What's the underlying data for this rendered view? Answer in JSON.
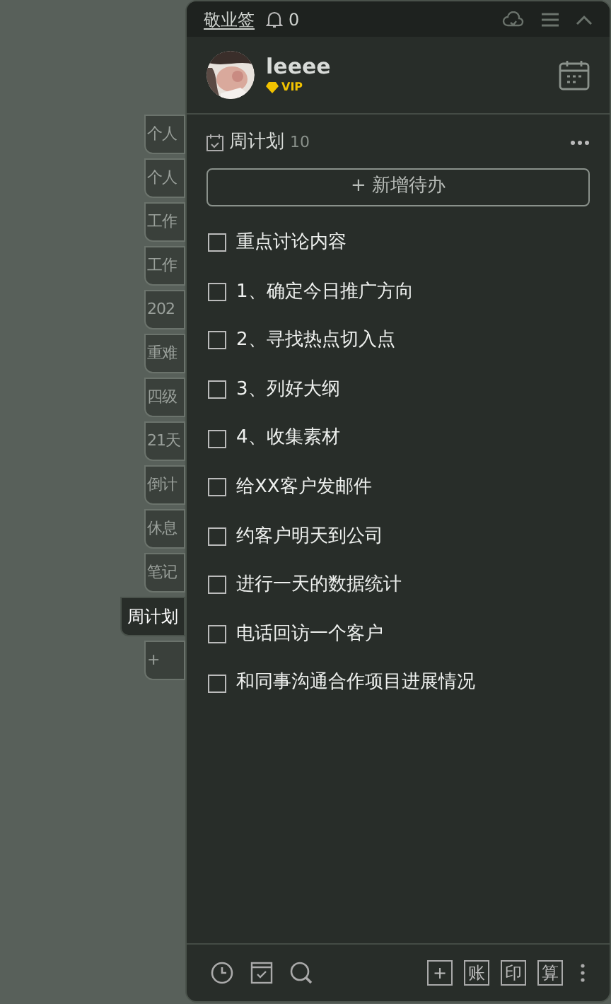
{
  "header": {
    "app_name": "敬业签",
    "notification_count": "0"
  },
  "user": {
    "name": "leeee",
    "badge": "VIP"
  },
  "side_tabs": [
    {
      "label": "个人",
      "selected": false
    },
    {
      "label": "个人",
      "selected": false
    },
    {
      "label": "工作",
      "selected": false
    },
    {
      "label": "工作",
      "selected": false
    },
    {
      "label": "202",
      "selected": false
    },
    {
      "label": "重难",
      "selected": false
    },
    {
      "label": "四级",
      "selected": false
    },
    {
      "label": "21天",
      "selected": false
    },
    {
      "label": "倒计",
      "selected": false
    },
    {
      "label": "休息",
      "selected": false
    },
    {
      "label": "笔记",
      "selected": false
    },
    {
      "label": "周计划",
      "selected": true
    },
    {
      "label": "+",
      "selected": false
    }
  ],
  "list": {
    "title": "周计划",
    "count": "10",
    "add_button": "+ 新增待办",
    "items": [
      {
        "text": "重点讨论内容",
        "checked": false
      },
      {
        "text": "1、确定今日推广方向",
        "checked": false
      },
      {
        "text": "2、寻找热点切入点",
        "checked": false
      },
      {
        "text": "3、列好大纲",
        "checked": false
      },
      {
        "text": "4、收集素材",
        "checked": false
      },
      {
        "text": "给XX客户发邮件",
        "checked": false
      },
      {
        "text": "约客户明天到公司",
        "checked": false
      },
      {
        "text": "进行一天的数据统计",
        "checked": false
      },
      {
        "text": "电话回访一个客户",
        "checked": false
      },
      {
        "text": "和同事沟通合作项目进展情况",
        "checked": false
      }
    ]
  },
  "footer_buttons": [
    "+",
    "账",
    "印",
    "算"
  ]
}
